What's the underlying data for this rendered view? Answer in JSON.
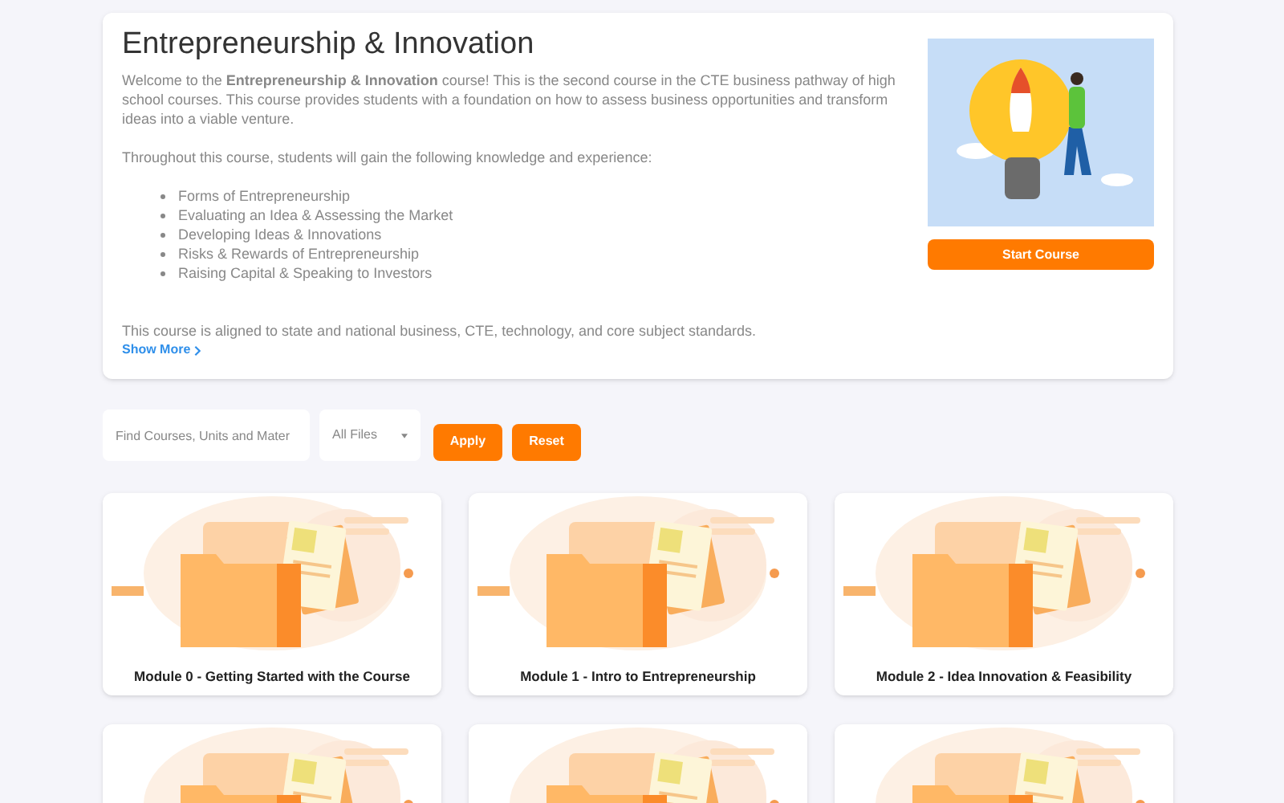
{
  "course": {
    "title": "Entrepreneurship & Innovation",
    "intro": "Welcome to the **Entrepreneurship & Innovation** course! This is the second course in the CTE business pathway of high school courses. This course provides students with a foundation on how to assess business opportunities and transform ideas into a viable venture.",
    "lead": "Throughout this course, students will gain the following knowledge and experience:",
    "topics": [
      "Forms of Entrepreneurship",
      "Evaluating an Idea & Assessing the Market",
      "Developing Ideas & Innovations",
      "Risks & Rewards of Entrepreneurship",
      "Raising Capital & Speaking to Investors"
    ],
    "standards": "This course is aligned to state and national business, CTE, technology, and core subject standards.",
    "show_more": "Show More",
    "start_button": "Start Course"
  },
  "filters": {
    "search": {
      "placeholder": "Find Courses, Units and Mater"
    },
    "file_type": {
      "value": "All Files"
    },
    "apply": "Apply",
    "reset": "Reset"
  },
  "modules": [
    {
      "kind": "full",
      "title": "Module 0 - Getting Started with the Course"
    },
    {
      "kind": "full",
      "title": "Module 1 - Intro to Entrepreneurship"
    },
    {
      "kind": "full",
      "title": "Module 2 - Idea Innovation & Feasibility"
    },
    {
      "kind": "cut_off"
    },
    {
      "kind": "cut_off"
    },
    {
      "kind": "cut_off"
    }
  ]
}
